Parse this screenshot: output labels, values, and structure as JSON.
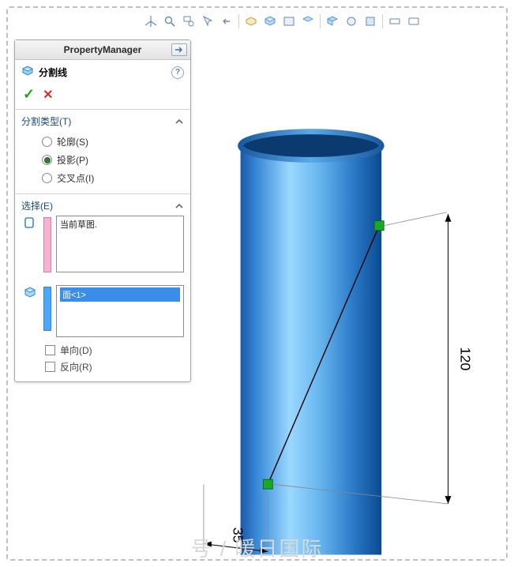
{
  "toolbar": {
    "icons": [
      "axis-icon",
      "zoom-fit-icon",
      "zoom-area-icon",
      "select-icon",
      "prev-view-icon",
      "options-icon",
      "section-icon",
      "display-icon",
      "scene-icon",
      "view-icon",
      "hide-icon",
      "annotate-icon",
      "copy-icon",
      "flat-icon",
      "screen-icon"
    ]
  },
  "pm": {
    "header": "PropertyManager",
    "feature_title": "分割线",
    "sections": {
      "split_type": {
        "label": "分割类型(T)",
        "options": {
          "silhouette": "轮廓(S)",
          "projection": "投影(P)",
          "intersection": "交叉点(I)"
        },
        "selected": "projection"
      },
      "select": {
        "label": "选择(E)",
        "sketch_item": "当前草图.",
        "face_item": "面<1>",
        "single_dir": "单向(D)",
        "reverse": "反向(R)"
      }
    }
  },
  "viewport": {
    "dim_vertical": "120",
    "dim_bottom": "35"
  },
  "watermark": {
    "left": "号",
    "sep": "/",
    "right": "暖日国际"
  }
}
